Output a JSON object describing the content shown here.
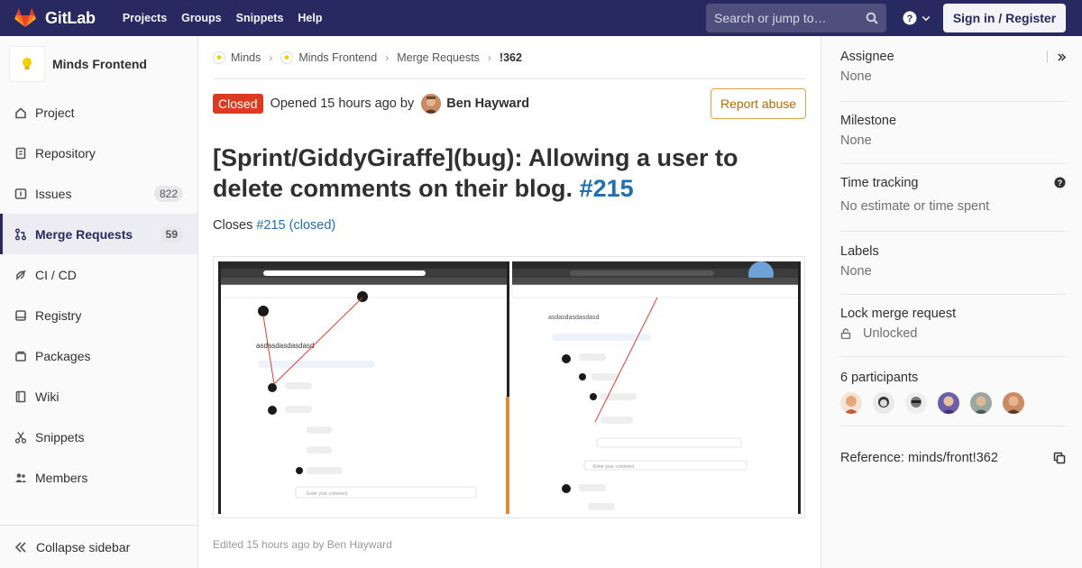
{
  "navbar": {
    "brand": "GitLab",
    "links": [
      "Projects",
      "Groups",
      "Snippets",
      "Help"
    ],
    "search_placeholder": "Search or jump to…",
    "signin": "Sign in / Register"
  },
  "sidebar": {
    "project_name": "Minds Frontend",
    "items": [
      {
        "label": "Project",
        "icon": "home-icon"
      },
      {
        "label": "Repository",
        "icon": "doc-icon"
      },
      {
        "label": "Issues",
        "icon": "issues-icon",
        "badge": "822"
      },
      {
        "label": "Merge Requests",
        "icon": "merge-request-icon",
        "badge": "59"
      },
      {
        "label": "CI / CD",
        "icon": "rocket-icon"
      },
      {
        "label": "Registry",
        "icon": "registry-icon"
      },
      {
        "label": "Packages",
        "icon": "package-icon"
      },
      {
        "label": "Wiki",
        "icon": "book-icon"
      },
      {
        "label": "Snippets",
        "icon": "scissors-icon"
      },
      {
        "label": "Members",
        "icon": "users-icon"
      }
    ],
    "collapse": "Collapse sidebar"
  },
  "breadcrumb": [
    "Minds",
    "Minds Frontend",
    "Merge Requests",
    "!362"
  ],
  "mr": {
    "status": "Closed",
    "opened": "Opened 15 hours ago by",
    "author": "Ben Hayward",
    "report": "Report abuse",
    "title": "[Sprint/GiddyGiraffe](bug): Allowing a user to delete comments on their blog.",
    "title_ref": "#215",
    "closes_prefix": "Closes",
    "closes_link": "#215 (closed)",
    "edited": "Edited 15 hours ago by Ben Hayward"
  },
  "screenshot": {
    "left_text": "asdasdasdasdasd",
    "right_text": "asdasdasdasdasd",
    "placeholder": "Enter your comment"
  },
  "right": {
    "assignee_title": "Assignee",
    "assignee_value": "None",
    "milestone_title": "Milestone",
    "milestone_value": "None",
    "time_title": "Time tracking",
    "time_value": "No estimate or time spent",
    "labels_title": "Labels",
    "labels_value": "None",
    "lock_title": "Lock merge request",
    "lock_value": "Unlocked",
    "participants_title": "6 participants",
    "participants_count": 6,
    "reference": "Reference: minds/front!362"
  },
  "colors": {
    "nav_bg": "#292961",
    "closed": "#db3b21",
    "link": "#1f6fb2",
    "report": "#e1a34a"
  }
}
